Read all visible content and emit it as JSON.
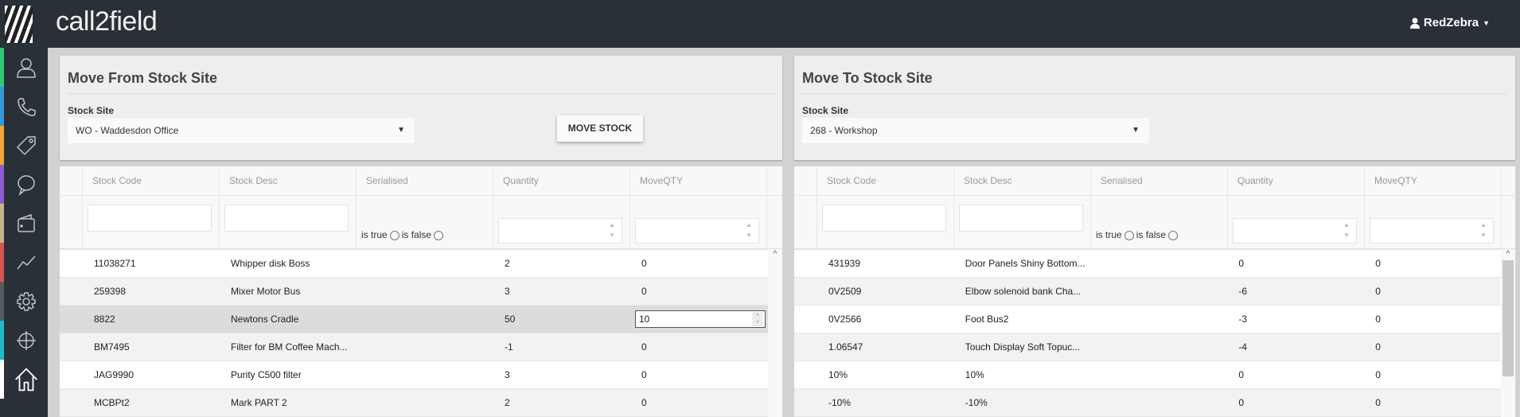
{
  "app": {
    "brand": "call2field",
    "user": "RedZebra"
  },
  "sidebar": [
    {
      "icon": "user-icon",
      "color": "#2ecc71"
    },
    {
      "icon": "phone-icon",
      "color": "#3498db"
    },
    {
      "icon": "tag-icon",
      "color": "#f0a830"
    },
    {
      "icon": "chat-icon",
      "color": "#8e5bd0"
    },
    {
      "icon": "wallet-icon",
      "color": "#c8b48a"
    },
    {
      "icon": "chart-icon",
      "color": "#d9534f"
    },
    {
      "icon": "gear-icon",
      "color": "#555b60"
    },
    {
      "icon": "crosshair-icon",
      "color": "#1abcc8"
    },
    {
      "icon": "home-icon",
      "color": "#ffffff"
    }
  ],
  "from": {
    "title": "Move From Stock Site",
    "label": "Stock Site",
    "site": "WO - Waddesdon Office",
    "button": "MOVE STOCK"
  },
  "to": {
    "title": "Move To Stock Site",
    "label": "Stock Site",
    "site": "268 - Workshop"
  },
  "columns": [
    "Stock Code",
    "Stock Desc",
    "Serialised",
    "Quantity",
    "MoveQTY"
  ],
  "filters": {
    "is_true": "is true",
    "is_false": "is false"
  },
  "from_rows": [
    [
      "11038271",
      "Whipper disk Boss",
      "2",
      "0"
    ],
    [
      "259398",
      "Mixer Motor Bus",
      "3",
      "0"
    ],
    [
      "8822",
      "Newtons Cradle",
      "50",
      "10"
    ],
    [
      "BM7495",
      "Filter for BM Coffee Mach...",
      "-1",
      "0"
    ],
    [
      "JAG9990",
      "Purity C500 filter",
      "3",
      "0"
    ],
    [
      "MCBPt2",
      "Mark PART 2",
      "2",
      "0"
    ]
  ],
  "to_rows": [
    [
      "431939",
      "Door Panels Shiny Bottom...",
      "0",
      "0"
    ],
    [
      "0V2509",
      "Elbow solenoid bank Cha...",
      "-6",
      "0"
    ],
    [
      "0V2566",
      "Foot Bus2",
      "-3",
      "0"
    ],
    [
      "1.06547",
      "Touch Display Soft Topuc...",
      "-4",
      "0"
    ],
    [
      "10%",
      "10%",
      "0",
      "0"
    ],
    [
      "-10%",
      "-10%",
      "0",
      "0"
    ]
  ]
}
